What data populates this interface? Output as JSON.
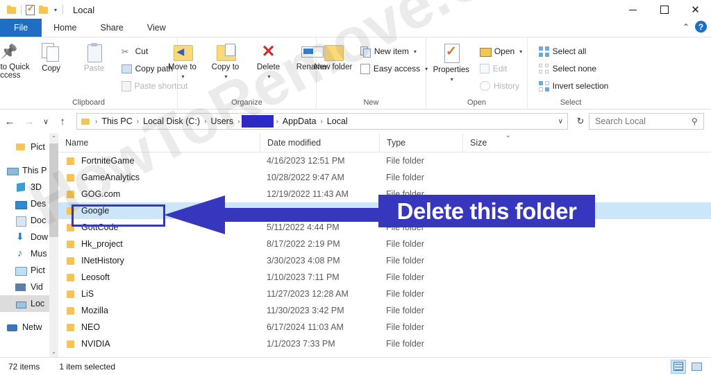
{
  "window": {
    "title": "Local",
    "quick_access": [
      "folder-icon",
      "properties-icon",
      "new-folder-icon"
    ],
    "controls": {
      "minimize": "minimize-icon",
      "maximize": "maximize-icon",
      "close": "✕"
    }
  },
  "ribbon": {
    "tabs": [
      {
        "label": "File",
        "state": "file"
      },
      {
        "label": "Home",
        "state": "active"
      },
      {
        "label": "Share",
        "state": "normal"
      },
      {
        "label": "View",
        "state": "normal"
      }
    ],
    "collapse_label": "⌃",
    "help_label": "?",
    "groups": [
      {
        "name": "Clipboard",
        "big": [
          {
            "label": "Pin to Quick access",
            "icon": "pin-icon",
            "dim": false
          },
          {
            "label": "Copy",
            "icon": "copy-icon",
            "dim": false
          },
          {
            "label": "Paste",
            "icon": "paste-icon",
            "dim": true
          }
        ],
        "small": [
          {
            "label": "Cut",
            "icon": "cut-icon",
            "dim": false
          },
          {
            "label": "Copy path",
            "icon": "copy-path-icon",
            "dim": false
          },
          {
            "label": "Paste shortcut",
            "icon": "paste-shortcut-icon",
            "dim": true
          }
        ]
      },
      {
        "name": "Organize",
        "big": [
          {
            "label": "Move to",
            "icon": "move-to-icon",
            "caret": true
          },
          {
            "label": "Copy to",
            "icon": "copy-to-icon",
            "caret": true
          },
          {
            "label": "Delete",
            "icon": "delete-icon",
            "caret": true
          },
          {
            "label": "Rename",
            "icon": "rename-icon",
            "caret": false
          }
        ]
      },
      {
        "name": "New",
        "big": [
          {
            "label": "New folder",
            "icon": "new-folder-icon"
          }
        ],
        "small": [
          {
            "label": "New item",
            "icon": "new-item-icon",
            "caret": true
          },
          {
            "label": "Easy access",
            "icon": "easy-access-icon",
            "caret": true
          }
        ]
      },
      {
        "name": "Open",
        "big": [
          {
            "label": "Properties",
            "icon": "properties-icon",
            "caret": true
          }
        ],
        "small": [
          {
            "label": "Open",
            "icon": "open-icon",
            "caret": true,
            "dim": false
          },
          {
            "label": "Edit",
            "icon": "edit-icon",
            "dim": true
          },
          {
            "label": "History",
            "icon": "history-icon",
            "dim": true
          }
        ]
      },
      {
        "name": "Select",
        "small": [
          {
            "label": "Select all",
            "icon": "select-all-icon"
          },
          {
            "label": "Select none",
            "icon": "select-none-icon"
          },
          {
            "label": "Invert selection",
            "icon": "invert-selection-icon"
          }
        ]
      }
    ]
  },
  "addressbar": {
    "back": "←",
    "forward": "→",
    "recent": "∨",
    "up": "↑",
    "crumbs": [
      "This PC",
      "Local Disk (C:)",
      "Users",
      "[redacted]",
      "AppData",
      "Local"
    ],
    "separator": "›",
    "dropdown": "∨",
    "refresh": "↻",
    "search_placeholder": "Search Local",
    "search_value": "",
    "search_icon": "🔍"
  },
  "sidebar": {
    "items": [
      {
        "label": "Pict",
        "icon": "folder-icon",
        "indent": true,
        "selected": false
      },
      {
        "label": "This P",
        "icon": "this-pc-icon",
        "indent": false,
        "selected": false
      },
      {
        "label": "3D",
        "icon": "3d-objects-icon",
        "indent": true,
        "selected": false
      },
      {
        "label": "Des",
        "icon": "desktop-icon",
        "indent": true,
        "selected": false
      },
      {
        "label": "Doc",
        "icon": "documents-icon",
        "indent": true,
        "selected": false
      },
      {
        "label": "Dow",
        "icon": "downloads-icon",
        "indent": true,
        "selected": false
      },
      {
        "label": "Mus",
        "icon": "music-icon",
        "indent": true,
        "selected": false
      },
      {
        "label": "Pict",
        "icon": "pictures-icon",
        "indent": true,
        "selected": false
      },
      {
        "label": "Vid",
        "icon": "videos-icon",
        "indent": true,
        "selected": false
      },
      {
        "label": "Loc",
        "icon": "local-disk-icon",
        "indent": true,
        "selected": true
      },
      {
        "label": "Netw",
        "icon": "network-icon",
        "indent": false,
        "selected": false
      }
    ],
    "scroll_up": "⌃",
    "scroll_down": "⌄"
  },
  "filelist": {
    "columns": [
      "Name",
      "Date modified",
      "Type",
      "Size"
    ],
    "sort_indicator": "⌄",
    "rows": [
      {
        "name": "FortniteGame",
        "date": "4/16/2023 12:51 PM",
        "type": "File folder",
        "size": "",
        "selected": false
      },
      {
        "name": "GameAnalytics",
        "date": "10/28/2022 9:47 AM",
        "type": "File folder",
        "size": "",
        "selected": false
      },
      {
        "name": "GOG.com",
        "date": "12/19/2022 11:43 AM",
        "type": "File folder",
        "size": "",
        "selected": false
      },
      {
        "name": "Google",
        "date": "",
        "type": "",
        "size": "",
        "selected": true
      },
      {
        "name": "GottCode",
        "date": "5/11/2022 4:44 PM",
        "type": "File folder",
        "size": "",
        "selected": false
      },
      {
        "name": "Hk_project",
        "date": "8/17/2022 2:19 PM",
        "type": "File folder",
        "size": "",
        "selected": false
      },
      {
        "name": "INetHistory",
        "date": "3/30/2023 4:08 PM",
        "type": "File folder",
        "size": "",
        "selected": false
      },
      {
        "name": "Leosoft",
        "date": "1/10/2023 7:11 PM",
        "type": "File folder",
        "size": "",
        "selected": false
      },
      {
        "name": "LiS",
        "date": "11/27/2023 12:28 AM",
        "type": "File folder",
        "size": "",
        "selected": false
      },
      {
        "name": "Mozilla",
        "date": "11/30/2023 3:42 PM",
        "type": "File folder",
        "size": "",
        "selected": false
      },
      {
        "name": "NEO",
        "date": "6/17/2024 11:03 AM",
        "type": "File folder",
        "size": "",
        "selected": false
      },
      {
        "name": "NVIDIA",
        "date": "1/1/2023 7:33 PM",
        "type": "File folder",
        "size": "",
        "selected": false
      }
    ]
  },
  "statusbar": {
    "item_count": "72 items",
    "selection": "1 item selected",
    "view_details": "details-view-icon",
    "view_icons": "large-icons-view-icon"
  },
  "annotation": {
    "banner_text": "Delete this folder",
    "color": "#3636bf",
    "target": "Google"
  },
  "watermark": {
    "text": "HowToRemove.Guide"
  }
}
